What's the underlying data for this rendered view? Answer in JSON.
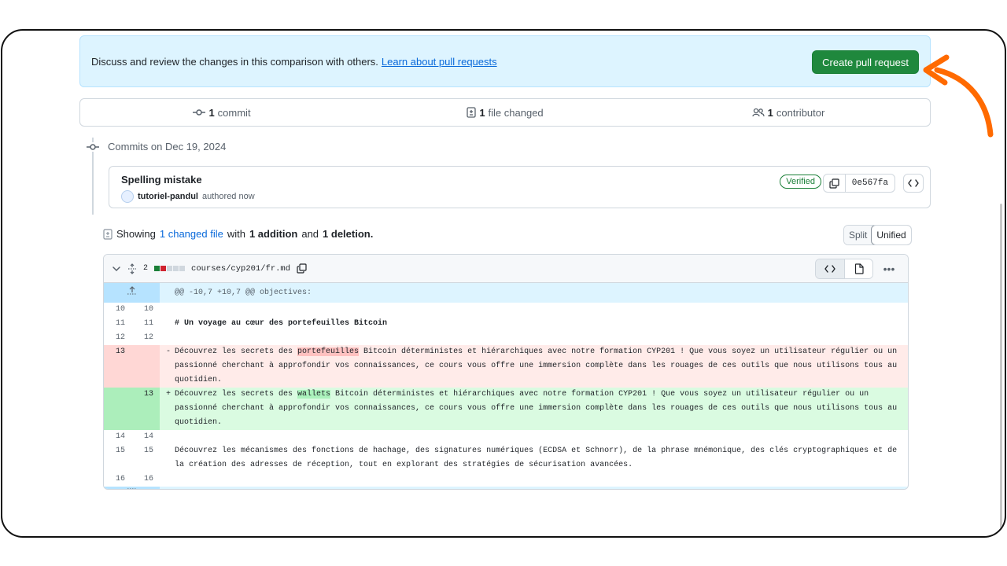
{
  "banner": {
    "message": "Discuss and review the changes in this comparison with others.",
    "link": "Learn about pull requests",
    "create_button": "Create pull request"
  },
  "summary": {
    "commits_count": "1",
    "commits_label": "commit",
    "files_count": "1",
    "files_label": "file changed",
    "contributors_count": "1",
    "contributors_label": "contributor"
  },
  "commits": {
    "heading": "Commits on Dec 19, 2024",
    "items": [
      {
        "title": "Spelling mistake",
        "author": "tutoriel-pandul",
        "time": "authored now",
        "badge": "Verified",
        "sha": "0e567fa"
      }
    ]
  },
  "showing": {
    "prefix": "Showing",
    "files_link": "1 changed file",
    "with": "with",
    "additions": "1 addition",
    "and": "and",
    "deletions": "1 deletion."
  },
  "view_toggle": {
    "split": "Split",
    "unified": "Unified"
  },
  "file": {
    "changes": "2",
    "path": "courses/cyp201/fr.md",
    "hunk_header": "@@ -10,7 +10,7 @@ objectives:",
    "lines": [
      {
        "old": "10",
        "new": "10",
        "sign": "",
        "text": ""
      },
      {
        "old": "11",
        "new": "11",
        "sign": "",
        "text": "# Un voyage au cœur des portefeuilles Bitcoin"
      },
      {
        "old": "12",
        "new": "12",
        "sign": "",
        "text": ""
      },
      {
        "old": "13",
        "new": "",
        "sign": "-",
        "before": "Découvrez les secrets des ",
        "highlight": "portefeuilles",
        "after": " Bitcoin déterministes et hiérarchiques avec notre formation CYP201 ! Que vous soyez un utilisateur régulier ou un passionné cherchant à approfondir vos connaissances, ce cours vous offre une immersion complète dans les rouages de ces outils que nous utilisons tous au quotidien."
      },
      {
        "old": "",
        "new": "13",
        "sign": "+",
        "before": "Découvrez les secrets des ",
        "highlight": "wallets",
        "after": " Bitcoin déterministes et hiérarchiques avec notre formation CYP201 ! Que vous soyez un utilisateur régulier ou un passionné cherchant à approfondir vos connaissances, ce cours vous offre une immersion complète dans les rouages de ces outils que nous utilisons tous au quotidien."
      },
      {
        "old": "14",
        "new": "14",
        "sign": "",
        "text": ""
      },
      {
        "old": "15",
        "new": "15",
        "sign": "",
        "text": "Découvrez les mécanismes des fonctions de hachage, des signatures numériques (ECDSA et Schnorr), de la phrase mnémonique, des clés cryptographiques et de la création des adresses de réception, tout en explorant des stratégies de sécurisation avancées."
      },
      {
        "old": "16",
        "new": "16",
        "sign": "",
        "text": ""
      }
    ]
  },
  "colors": {
    "primary_button": "#1f883d",
    "link": "#0969da",
    "annotation_arrow": "#ff6a00",
    "deletion_bg": "#ffebe9",
    "addition_bg": "#dafbe1"
  }
}
